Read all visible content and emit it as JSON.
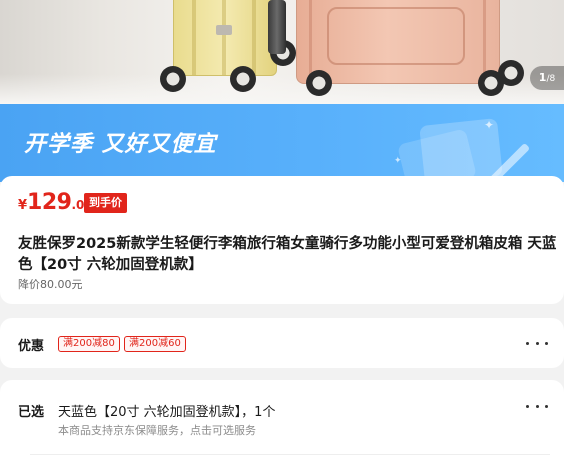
{
  "gallery": {
    "current_page": "1",
    "total_pages": "8"
  },
  "banner": {
    "title": "开学季 又好又便宜"
  },
  "price": {
    "symbol": "¥",
    "integer": "129",
    "decimal": ".00",
    "badge": "到手价",
    "color": "#e1251b"
  },
  "product": {
    "title": "友胜保罗2025新款学生轻便行李箱旅行箱女童骑行多功能小型可爱登机箱皮箱 天蓝色【20寸 六轮加固登机款】",
    "original_price": "降价80.00元"
  },
  "promotions": {
    "label": "优惠",
    "coupons": [
      "满200减80",
      "满200减60"
    ]
  },
  "selected": {
    "label": "已选",
    "value": "天蓝色【20寸 六轮加固登机款】，1个",
    "service_note": "本商品支持京东保障服务，点击可选服务"
  },
  "colors": {
    "accent_red": "#e1251b",
    "banner_blue": "#58b0fb"
  }
}
